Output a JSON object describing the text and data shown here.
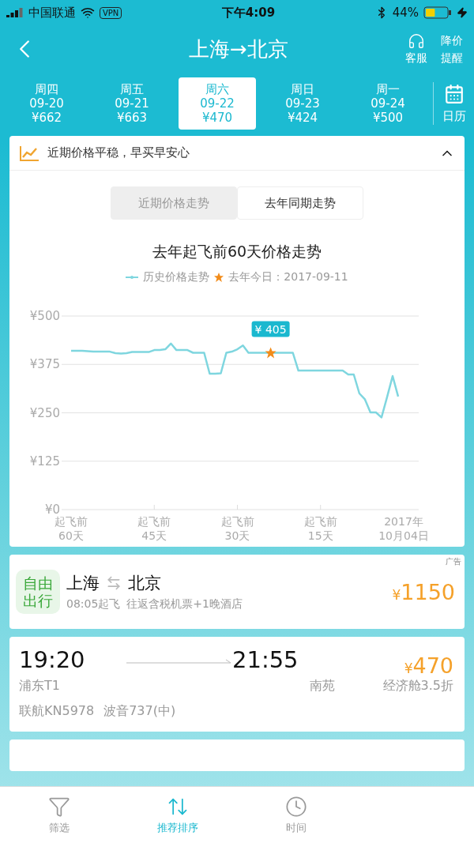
{
  "status_bar": {
    "carrier": "中国联通",
    "vpn": "VPN",
    "time": "下午4:09",
    "battery": "44%"
  },
  "header": {
    "title": "上海→北京",
    "service": "客服",
    "alert": "降价提醒"
  },
  "date_tabs": [
    {
      "weekday": "周四",
      "date": "09-20",
      "price": "¥662",
      "selected": false
    },
    {
      "weekday": "周五",
      "date": "09-21",
      "price": "¥663",
      "selected": false
    },
    {
      "weekday": "周六",
      "date": "09-22",
      "price": "¥470",
      "selected": true
    },
    {
      "weekday": "周日",
      "date": "09-23",
      "price": "¥424",
      "selected": false
    },
    {
      "weekday": "周一",
      "date": "09-24",
      "price": "¥500",
      "selected": false
    }
  ],
  "calendar": "日历",
  "trend_card": {
    "tip": "近期价格平稳，早买早安心",
    "expanded": true,
    "segments": [
      {
        "label": "近期价格走势",
        "selected": false
      },
      {
        "label": "去年同期走势",
        "selected": true
      }
    ],
    "chart_data": {
      "type": "line",
      "title": "去年起飞前60天价格走势",
      "categories": [
        "起飞前\n60天",
        null,
        null,
        null,
        null,
        null,
        null,
        null,
        null,
        null,
        null,
        null,
        null,
        null,
        null,
        "起飞前\n45天",
        null,
        null,
        null,
        null,
        null,
        null,
        null,
        null,
        null,
        null,
        null,
        null,
        null,
        null,
        "起飞前\n30天",
        null,
        null,
        null,
        null,
        null,
        null,
        null,
        null,
        null,
        null,
        null,
        null,
        null,
        null,
        "起飞前\n15天",
        null,
        null,
        null,
        null,
        null,
        null,
        null,
        null,
        null,
        null,
        null,
        null,
        null,
        null,
        "2017年\n10月04日"
      ],
      "series": [
        {
          "name": "历史价格走势",
          "color": "#7fd6df",
          "values": [
            410,
            410,
            410,
            409,
            408,
            408,
            408,
            408,
            404,
            403,
            404,
            407,
            407,
            407,
            407,
            412,
            412,
            414,
            429,
            412,
            412,
            412,
            405,
            405,
            405,
            351,
            351,
            352,
            405,
            408,
            414,
            424,
            405,
            405,
            405,
            405,
            405,
            405,
            405,
            405,
            405,
            359,
            359,
            359,
            359,
            359,
            359,
            359,
            359,
            359,
            349,
            349,
            300,
            285,
            251,
            251,
            238,
            290,
            345,
            292,
            null
          ]
        },
        {
          "name": "去年今日：2017-09-11",
          "color": "#f28c1a",
          "marker": "star",
          "values": [
            null,
            null,
            null,
            null,
            null,
            null,
            null,
            null,
            null,
            null,
            null,
            null,
            null,
            null,
            null,
            null,
            null,
            null,
            null,
            null,
            null,
            null,
            null,
            null,
            null,
            null,
            null,
            null,
            null,
            null,
            null,
            null,
            null,
            null,
            null,
            null,
            405,
            null,
            null,
            null,
            null,
            null,
            null,
            null,
            null,
            null,
            null,
            null,
            null,
            null,
            null,
            null,
            null,
            null,
            null,
            null,
            null,
            null,
            null,
            null,
            null
          ]
        }
      ],
      "ylim": [
        0,
        500
      ],
      "grid": true,
      "yticks": [
        {
          "value": 0,
          "label": "¥0"
        },
        {
          "value": 125,
          "label": "¥125"
        },
        {
          "value": 250,
          "label": "¥250"
        },
        {
          "value": 375,
          "label": "¥375"
        },
        {
          "value": 500,
          "label": "¥500"
        }
      ],
      "annotations": [
        "¥ 405"
      ]
    }
  },
  "ad_card": {
    "badge": "自由出行",
    "tag": "广告",
    "from": "上海",
    "to": "北京",
    "departure": "08:05起飞",
    "description": "往返含税机票+1晚酒店",
    "currency": "¥",
    "price": "1150"
  },
  "flights": [
    {
      "depart_time": "19:20",
      "arrive_time": "21:55",
      "depart_airport": "浦东T1",
      "arrive_airport": "南苑",
      "currency": "¥",
      "price": "470",
      "cabin": "经济舱3.5折",
      "flight_no": "联航KN5978",
      "aircraft": "波音737(中)"
    }
  ],
  "bottom_tabs": [
    {
      "kind": "filter",
      "label": "筛选",
      "selected": false
    },
    {
      "kind": "sort",
      "label": "推荐排序",
      "selected": true
    },
    {
      "kind": "time",
      "label": "时间",
      "selected": false
    }
  ]
}
